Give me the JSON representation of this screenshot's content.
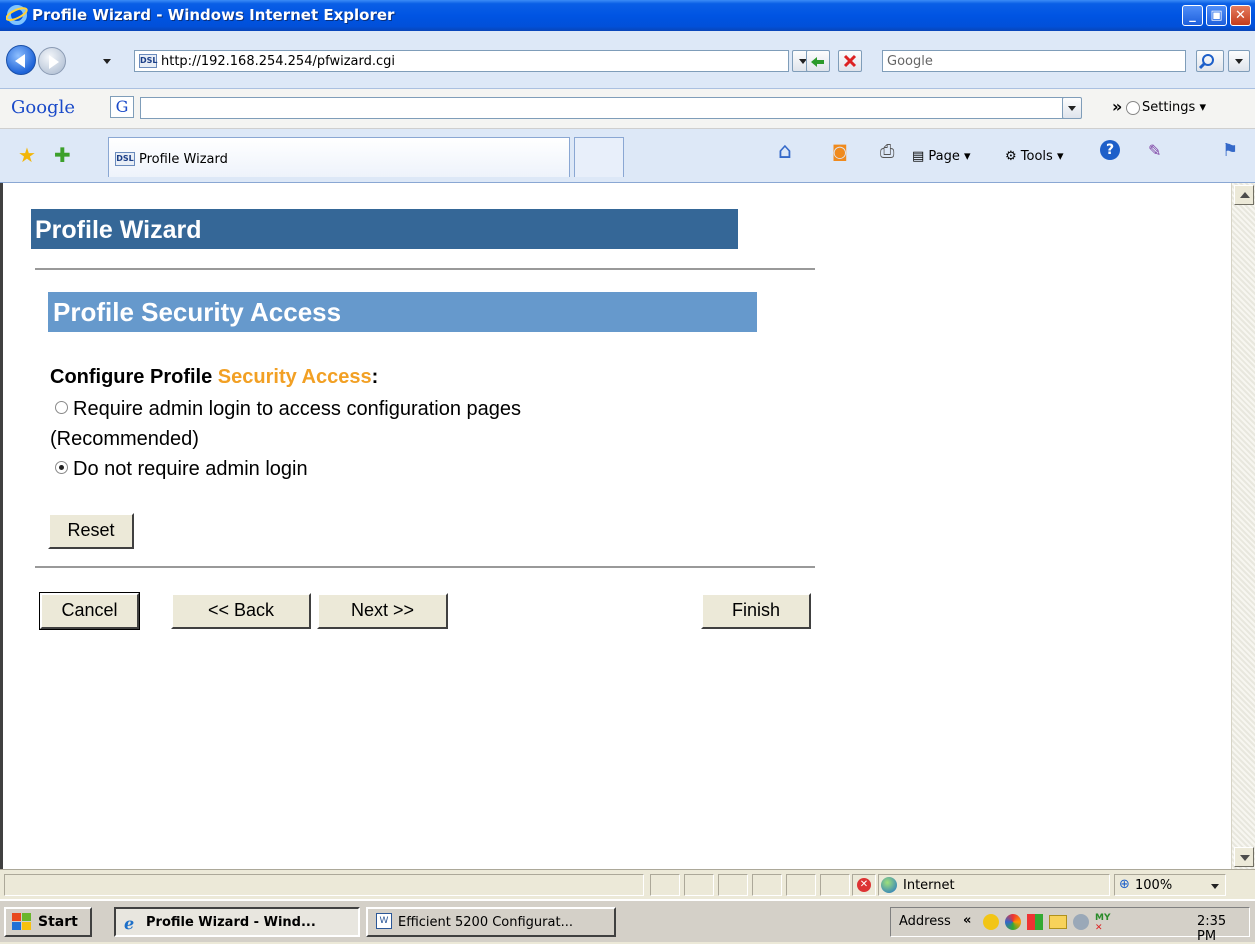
{
  "window": {
    "title": "Profile Wizard - Windows Internet Explorer",
    "minimize_glyph": "_",
    "maximize_glyph": "▣",
    "close_glyph": "✕"
  },
  "nav": {
    "url": "http://192.168.254.254/pfwizard.cgi",
    "favicon_text": "DSL",
    "search_placeholder": "Google"
  },
  "google_toolbar": {
    "logo": "Google",
    "more_glyph": "»",
    "settings_label": "Settings"
  },
  "tabs": {
    "active_tab_label": "Profile Wizard",
    "favicon_text": "DSL",
    "page_label": "Page",
    "tools_label": "Tools"
  },
  "page": {
    "wizard_title": "Profile Wizard",
    "section_title": "Profile Security Access",
    "configure_prefix": "Configure Profile ",
    "configure_accent": "Security Access",
    "configure_suffix": ":",
    "option1_line1": "Require admin login to access configuration pages",
    "option1_line2": "(Recommended)",
    "option2": "Do not require admin login",
    "selected_option": 2,
    "reset_label": "Reset",
    "cancel_label": "Cancel",
    "back_label": "<< Back",
    "next_label": "Next >>",
    "finish_label": "Finish",
    "accent_color": "#f2a024",
    "header_color": "#356797",
    "subheader_color": "#6699cc"
  },
  "status": {
    "zone": "Internet",
    "zoom": "100%"
  },
  "taskbar": {
    "start_label": "Start",
    "task1": "Profile Wizard - Wind...",
    "task2": "Efficient 5200 Configurat...",
    "address_label": "Address",
    "time": "2:35 PM"
  }
}
